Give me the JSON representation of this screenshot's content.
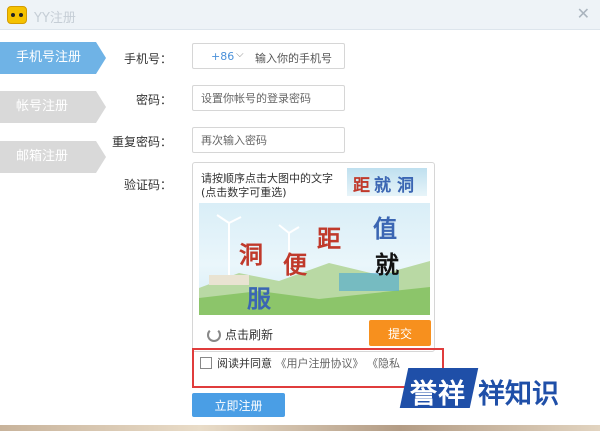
{
  "window": {
    "title": "YY注册"
  },
  "tabs": [
    {
      "label": "手机号注册",
      "active": true
    },
    {
      "label": "帐号注册",
      "active": false
    },
    {
      "label": "邮箱注册",
      "active": false
    }
  ],
  "form": {
    "phone_label": "手机号：",
    "country_code": "+86",
    "phone_placeholder": "输入你的手机号",
    "password_label": "密码：",
    "password_placeholder": "设置你帐号的登录密码",
    "repeat_label": "重复密码：",
    "repeat_placeholder": "再次输入密码",
    "captcha_label": "验证码："
  },
  "captcha": {
    "hint_line1": "请按顺序点击大图中的文字",
    "hint_line2": "(点击数字可重选)",
    "target_chars": [
      "距",
      "就",
      "洞"
    ],
    "image_chars": [
      {
        "char": "值",
        "color": "#3b66b3"
      },
      {
        "char": "距",
        "color": "#c0392b"
      },
      {
        "char": "洞",
        "color": "#c0392b"
      },
      {
        "char": "便",
        "color": "#c0392b"
      },
      {
        "char": "就",
        "color": "#111111"
      },
      {
        "char": "服",
        "color": "#3b66b3"
      }
    ],
    "refresh_label": "点击刷新",
    "submit_label": "提交"
  },
  "agreement": {
    "text": "阅读并同意",
    "link1": "《用户注册协议》",
    "link2": "《隐私"
  },
  "register_button": "立即注册",
  "watermark": {
    "badge": "誉祥",
    "text": "祥知识"
  },
  "icons": {
    "logo": "yy-bear-logo-icon",
    "close": "close-icon",
    "refresh": "refresh-icon",
    "chevron": "chevron-down-icon"
  },
  "colors": {
    "tab_active": "#6fb3e6",
    "tab_inactive": "#d9d9d9",
    "submit": "#f7901e",
    "register": "#4a9ee5",
    "highlight_border": "#e03c3c",
    "watermark_blue": "#1f4fa8"
  }
}
